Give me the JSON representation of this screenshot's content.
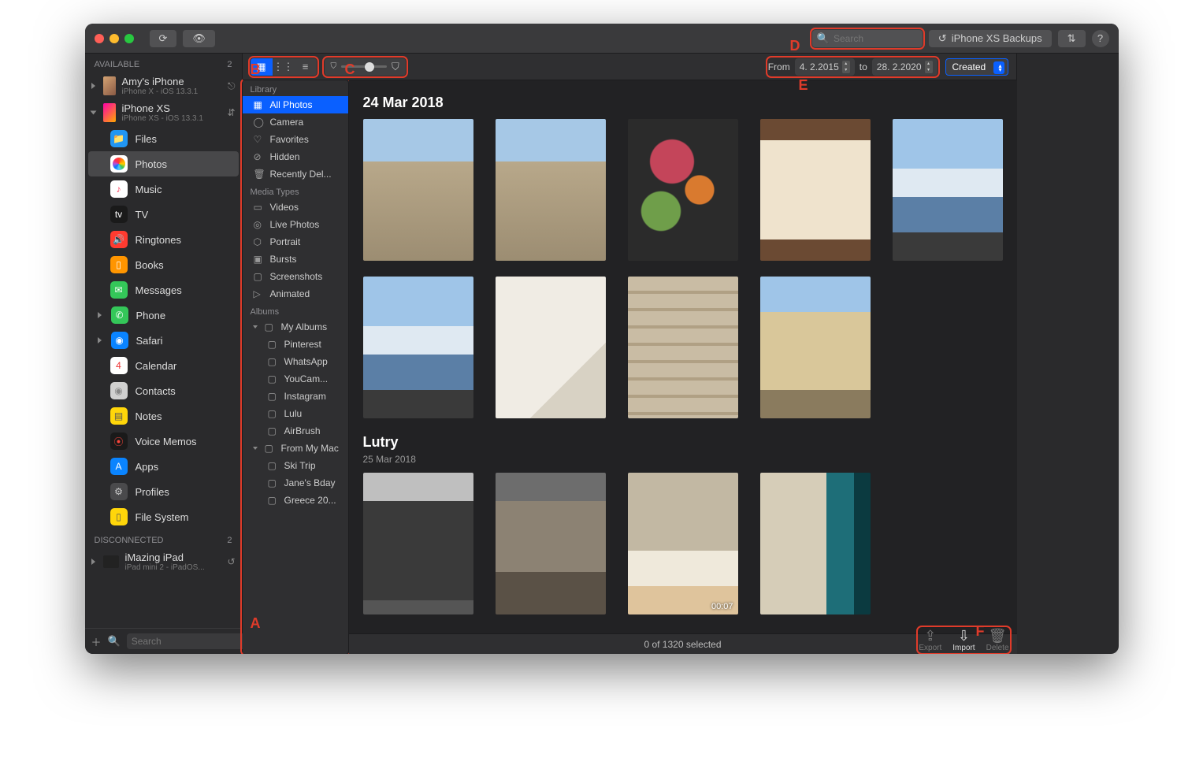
{
  "titlebar": {
    "search_placeholder": "Search",
    "backups_label": "iPhone XS Backups"
  },
  "callouts": {
    "a": "A",
    "b": "B",
    "c": "C",
    "d": "D",
    "e": "E",
    "f": "F"
  },
  "left": {
    "available_label": "AVAILABLE",
    "available_count": "2",
    "disconnected_label": "DISCONNECTED",
    "disconnected_count": "2",
    "devices": [
      {
        "name": "Amy's iPhone",
        "sub": "iPhone X - iOS 13.3.1",
        "conn": "wifi"
      },
      {
        "name": "iPhone XS",
        "sub": "iPhone XS - iOS 13.3.1",
        "conn": "usb"
      }
    ],
    "nav": [
      {
        "label": "Files",
        "color": "#2196f3",
        "glyph": "📁"
      },
      {
        "label": "Photos",
        "color": "#fff",
        "glyph": "✿",
        "selected": true,
        "icon": "photos"
      },
      {
        "label": "Music",
        "color": "#fc3d5b",
        "glyph": "♪",
        "bg": "#fff"
      },
      {
        "label": "TV",
        "color": "#fff",
        "glyph": "tv",
        "bg": "#1a1a1a"
      },
      {
        "label": "Ringtones",
        "color": "#fff",
        "glyph": "🔊",
        "bg": "#ff3b30"
      },
      {
        "label": "Books",
        "color": "#fff",
        "glyph": "▯",
        "bg": "#ff9500"
      },
      {
        "label": "Messages",
        "color": "#fff",
        "glyph": "✉",
        "bg": "#34c759"
      },
      {
        "label": "Phone",
        "color": "#fff",
        "glyph": "✆",
        "bg": "#34c759",
        "expand": true
      },
      {
        "label": "Safari",
        "color": "#fff",
        "glyph": "◉",
        "bg": "#0a84ff",
        "expand": true
      },
      {
        "label": "Calendar",
        "color": "#e33",
        "glyph": "4",
        "bg": "#fff"
      },
      {
        "label": "Contacts",
        "color": "#888",
        "glyph": "◉",
        "bg": "#d0d0d0"
      },
      {
        "label": "Notes",
        "color": "#555",
        "glyph": "▤",
        "bg": "#ffd60a"
      },
      {
        "label": "Voice Memos",
        "color": "#ff453a",
        "glyph": "⦿",
        "bg": "#1a1a1a"
      },
      {
        "label": "Apps",
        "color": "#fff",
        "glyph": "A",
        "bg": "#0a84ff"
      },
      {
        "label": "Profiles",
        "color": "#ccc",
        "glyph": "⚙",
        "bg": "#4a4a4c"
      },
      {
        "label": "File System",
        "color": "#555",
        "glyph": "▯",
        "bg": "#ffd60a"
      }
    ],
    "disconnected_device": {
      "name": "iMazing iPad",
      "sub": "iPad mini 2 - iPadOS..."
    },
    "bottom_search_placeholder": "Search"
  },
  "mid": {
    "library_label": "Library",
    "library_items": [
      {
        "label": "All Photos",
        "icon": "▦",
        "selected": true
      },
      {
        "label": "Camera",
        "icon": "◯"
      },
      {
        "label": "Favorites",
        "icon": "♡"
      },
      {
        "label": "Hidden",
        "icon": "⊘"
      },
      {
        "label": "Recently Del...",
        "icon": "🗑"
      }
    ],
    "media_label": "Media Types",
    "media_items": [
      {
        "label": "Videos",
        "icon": "▭"
      },
      {
        "label": "Live Photos",
        "icon": "◎"
      },
      {
        "label": "Portrait",
        "icon": "⬡"
      },
      {
        "label": "Bursts",
        "icon": "▣"
      },
      {
        "label": "Screenshots",
        "icon": "▢"
      },
      {
        "label": "Animated",
        "icon": "▷"
      }
    ],
    "albums_label": "Albums",
    "my_albums_label": "My Albums",
    "my_albums": [
      "Pinterest",
      "WhatsApp",
      "YouCam...",
      "Instagram",
      "Lulu",
      "AirBrush"
    ],
    "from_mac_label": "From My Mac",
    "from_mac": [
      "Ski Trip",
      "Jane's Bday",
      "Greece 20..."
    ]
  },
  "toolbar2": {
    "from_label": "From",
    "to_label": "to",
    "from_date": "4.  2.2015",
    "to_date": "28.  2.2020",
    "sort_label": "Created"
  },
  "content": {
    "section1_title": "24 Mar 2018",
    "section2_title": "Lutry",
    "section2_sub": "25 Mar 2018",
    "video_duration": "00:07"
  },
  "footer": {
    "status": "0 of 1320 selected",
    "export": "Export",
    "import": "Import",
    "delete": "Delete"
  }
}
